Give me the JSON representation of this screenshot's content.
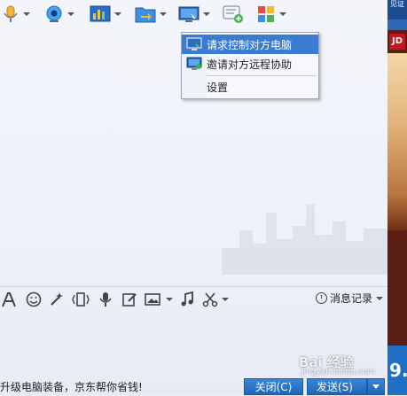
{
  "menu": {
    "items": [
      {
        "label": "请求控制对方电脑",
        "icon": "remote-control-icon"
      },
      {
        "label": "邀请对方远程协助",
        "icon": "remote-assist-icon"
      },
      {
        "label": "设置",
        "icon": ""
      }
    ]
  },
  "toolbar": {
    "icons": [
      "microphone-icon",
      "camera-icon",
      "app-share-icon",
      "file-transfer-icon",
      "remote-desktop-icon",
      "message-add-icon",
      "apps-grid-icon"
    ]
  },
  "input_toolbar": {
    "icons": [
      "font-icon",
      "emoji-icon",
      "magic-wand-icon",
      "vibrate-icon",
      "voice-icon",
      "edit-icon",
      "image-icon",
      "music-icon",
      "screenshot-icon"
    ]
  },
  "history": {
    "label": "消息记录"
  },
  "ad_bar": {
    "logo": "JD",
    "top_text": "见证",
    "bottom_text": "9."
  },
  "footer": {
    "ad_text": "升级电脑装备，京东帮你省钱!",
    "close_label": "关闭(C)",
    "send_label": "发送(S)"
  },
  "watermark": {
    "text": "Bai 经验",
    "sub": "jingyan.baidu.com"
  },
  "colors": {
    "accent": "#3b7bd2",
    "button": "#1f65b8"
  }
}
